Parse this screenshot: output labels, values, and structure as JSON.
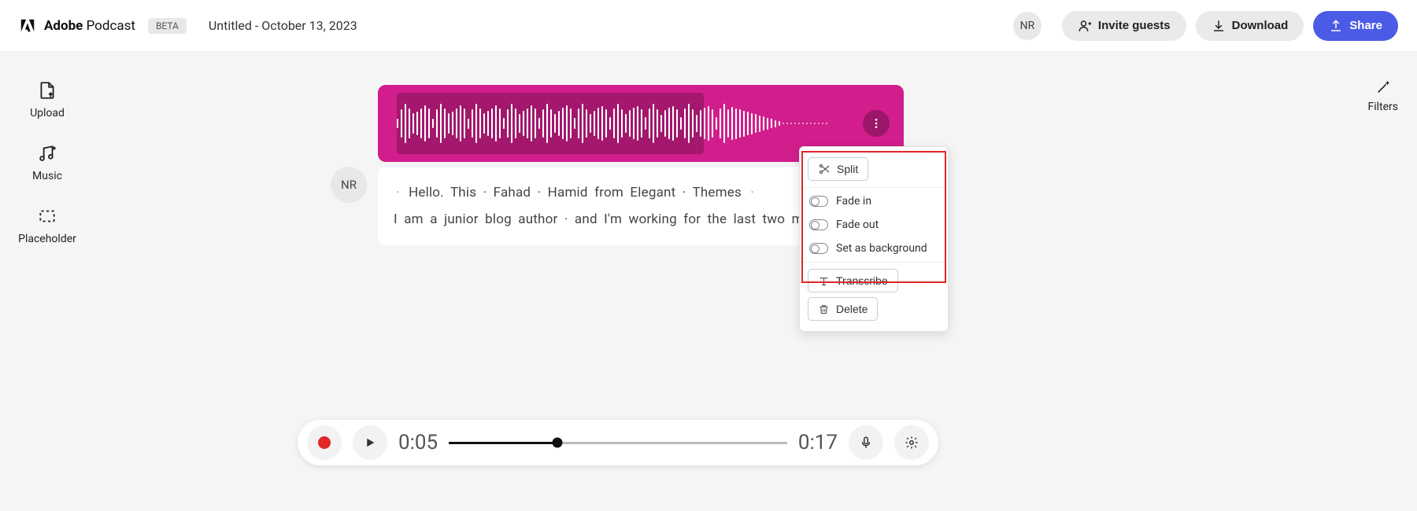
{
  "header": {
    "brand_bold": "Adobe",
    "brand_light": "Podcast",
    "beta": "BETA",
    "doc_title": "Untitled - October 13, 2023",
    "avatar": "NR",
    "invite": "Invite guests",
    "download": "Download",
    "share": "Share"
  },
  "left_rail": {
    "upload": "Upload",
    "music": "Music",
    "placeholder": "Placeholder"
  },
  "right_rail": {
    "filters": "Filters"
  },
  "transcript": {
    "avatar": "NR",
    "line1_parts": [
      "Hello.",
      "This",
      "Fahad",
      "Hamid",
      "from",
      "Elegant",
      "Themes"
    ],
    "line1": "Hello.  This · Fahad · Hamid  from  Elegant · Themes",
    "line2": "I  am  a  junior  blog  author · and  I'm  working  for  the  last  two  months."
  },
  "context_menu": {
    "split": "Split",
    "fade_in": "Fade in",
    "fade_out": "Fade out",
    "set_bg": "Set as background",
    "transcribe": "Transcribe",
    "delete": "Delete"
  },
  "player": {
    "current": "0:05",
    "total": "0:17"
  }
}
